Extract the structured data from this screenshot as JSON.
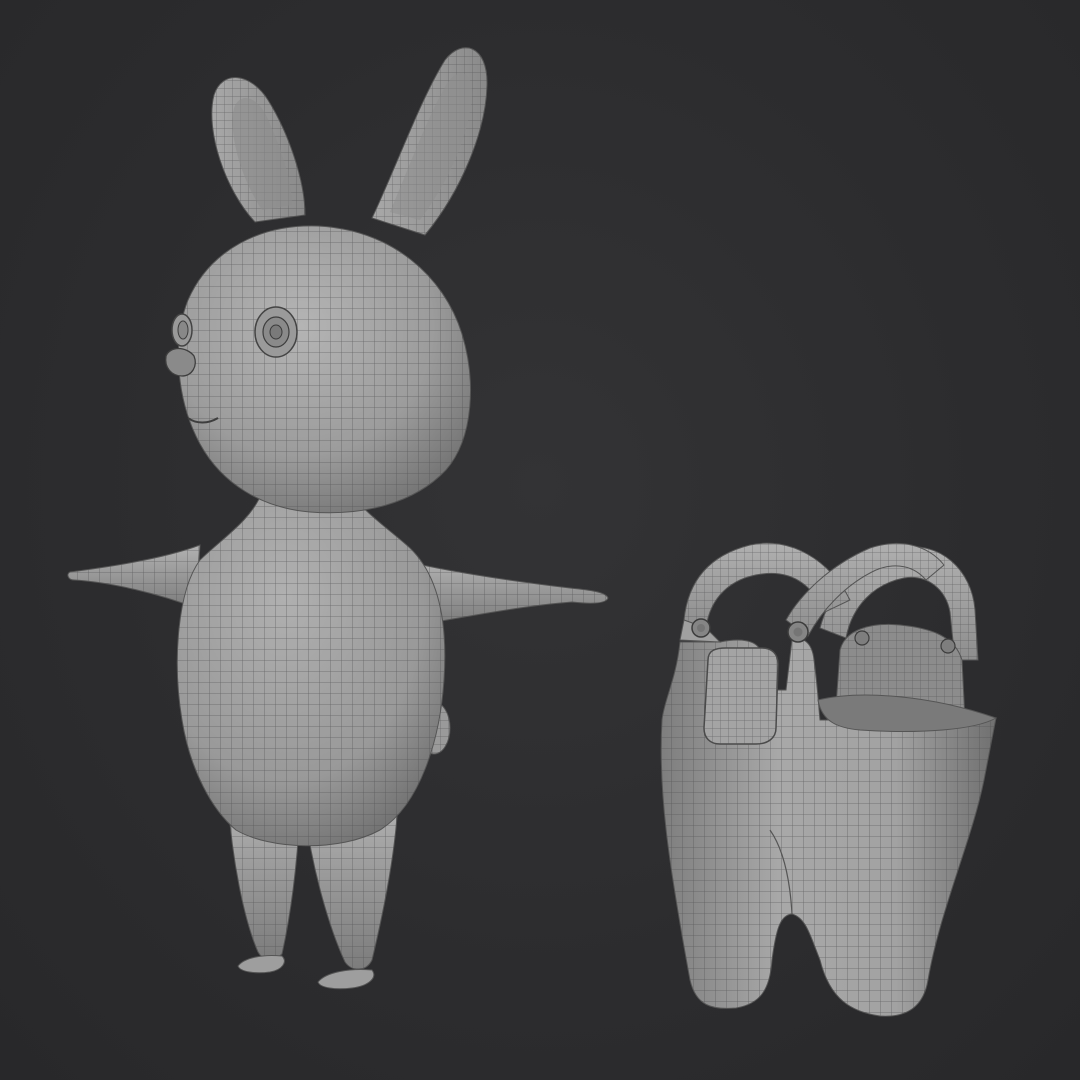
{
  "scene": {
    "background_color": "#2b2b2d",
    "mesh_color": "#9a9a9a",
    "wire_color": "#4a4a4a",
    "objects": [
      {
        "name": "bunny-character",
        "shading": "solid-wireframe",
        "parts": [
          "ears",
          "head",
          "eyes",
          "nose",
          "mouth",
          "torso",
          "arms",
          "legs",
          "feet",
          "tail"
        ]
      },
      {
        "name": "overalls",
        "shading": "solid-wireframe",
        "parts": [
          "straps",
          "buttons",
          "bib-pocket",
          "waist",
          "pant-legs"
        ]
      }
    ]
  }
}
